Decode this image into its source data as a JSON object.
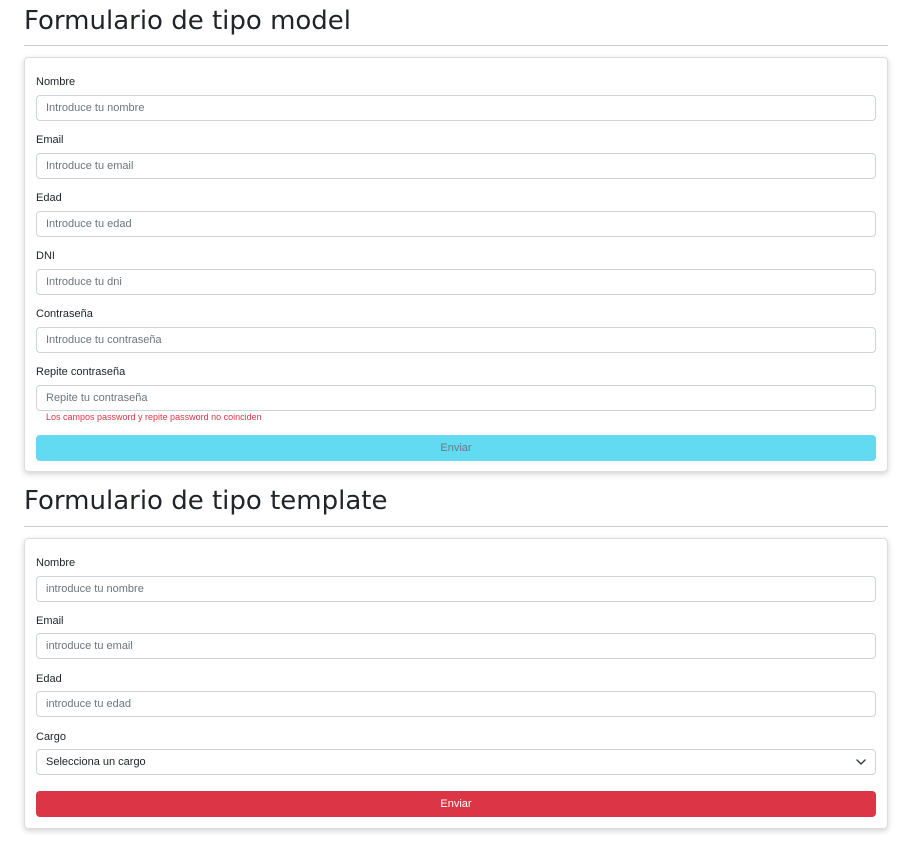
{
  "model_form": {
    "title": "Formulario de tipo model",
    "fields": [
      {
        "label": "Nombre",
        "placeholder": "Introduce tu nombre"
      },
      {
        "label": "Email",
        "placeholder": "Introduce tu email"
      },
      {
        "label": "Edad",
        "placeholder": "Introduce tu edad"
      },
      {
        "label": "DNI",
        "placeholder": "Introduce tu dni"
      },
      {
        "label": "Contraseña",
        "placeholder": "Introduce tu contraseña"
      },
      {
        "label": "Repite contraseña",
        "placeholder": "Repite tu contraseña"
      }
    ],
    "error_message": "Los campos password y repite password no coinciden",
    "submit_label": "Enviar",
    "submit_color": "#62daf2"
  },
  "template_form": {
    "title": "Formulario de tipo template",
    "fields": [
      {
        "label": "Nombre",
        "placeholder": "introduce tu nombre"
      },
      {
        "label": "Email",
        "placeholder": "introduce tu email"
      },
      {
        "label": "Edad",
        "placeholder": "introduce tu edad"
      }
    ],
    "select": {
      "label": "Cargo",
      "value": "Selecciona un cargo",
      "icon": "chevron-down-icon"
    },
    "submit_label": "Enviar",
    "submit_color": "#dc3545"
  }
}
